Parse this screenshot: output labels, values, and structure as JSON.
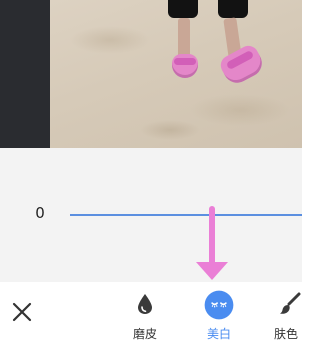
{
  "editor": {
    "slider": {
      "value": "0",
      "level": 0.0
    },
    "toolbar": {
      "close_icon": "close-icon",
      "tools": [
        {
          "label": "磨皮",
          "icon": "droplet-icon",
          "active": false
        },
        {
          "label": "美白",
          "icon": "smile-face-icon",
          "active": true
        },
        {
          "label": "肤色",
          "icon": "brush-icon",
          "active": false
        }
      ]
    }
  },
  "colors": {
    "accent": "#4a8cf0",
    "slider_track": "#5b8fe0",
    "annotation_arrow": "#ea7fd6",
    "panel_bg": "#f3f3f3"
  }
}
